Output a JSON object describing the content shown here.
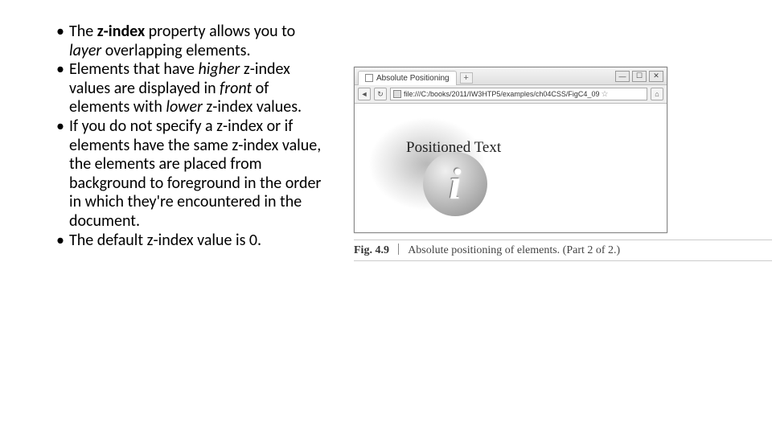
{
  "bullets": {
    "b1a": "The ",
    "b1b": "z-index",
    "b1c": " property allows you to ",
    "b1d": "layer",
    "b1e": " overlapping elements.",
    "b2a": "Elements that have ",
    "b2b": "higher",
    "b2c": " z-index values are displayed in ",
    "b2d": "front",
    "b2e": " of elements with ",
    "b2f": "lower",
    "b2g": " z-index values.",
    "b3": "If you do not specify a z-index or if elements have the same z-index value, the elements are placed from background to foreground in the order in which they're encountered in the document.",
    "b4": "The default z-index value is 0."
  },
  "browser": {
    "tab_title": "Absolute Positioning",
    "plus": "+",
    "min": "—",
    "max": "☐",
    "close": "✕",
    "back": "◄",
    "reload": "↻",
    "url": "file:///C:/books/2011/IW3HTP5/examples/ch04CSS/FigC4_09",
    "home": "⌂",
    "positioned_text": "Positioned Text",
    "i_glyph": "i"
  },
  "caption": {
    "fig": "Fig. 4.9",
    "text": "Absolute positioning of elements. (Part 2 of 2.)"
  }
}
